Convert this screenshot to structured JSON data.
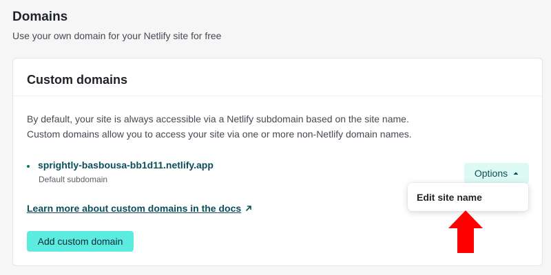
{
  "header": {
    "title": "Domains",
    "subtitle": "Use your own domain for your Netlify site for free"
  },
  "card": {
    "title": "Custom domains",
    "description_line1": "By default, your site is always accessible via a Netlify subdomain based on the site name.",
    "description_line2": "Custom domains allow you to access your site via one or more non-Netlify domain names."
  },
  "domain": {
    "name": "sprightly-basbousa-bb1d11.netlify.app",
    "label": "Default subdomain"
  },
  "options_button": {
    "label": "Options",
    "icon": "chevron-up-icon"
  },
  "options_menu": {
    "items": [
      "Edit site name"
    ]
  },
  "learn_link": {
    "text": "Learn more about custom domains in the docs",
    "icon": "external-link-icon"
  },
  "add_button": {
    "label": "Add custom domain"
  },
  "annotation": {
    "icon": "red-arrow-up-icon",
    "color": "#ff0000"
  },
  "colors": {
    "accent_teal": "#5cebdf",
    "link": "#0c4d5a",
    "options_bg": "#dcfaf3"
  }
}
